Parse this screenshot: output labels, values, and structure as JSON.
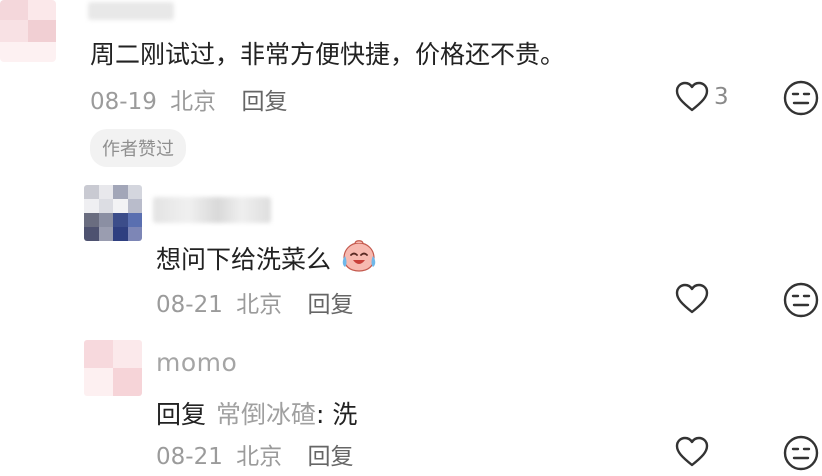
{
  "comments": [
    {
      "text": "周二刚试过，非常方便快捷，价格还不贵。",
      "date": "08-19",
      "location": "北京",
      "reply_label": "回复",
      "likes": "3",
      "badge": "作者赞过"
    },
    {
      "text": "想问下给洗菜么",
      "emoji_name": "crying-laughing-face-icon",
      "date": "08-21",
      "location": "北京",
      "reply_label": "回复"
    },
    {
      "username": "momo",
      "reply_prefix": "回复",
      "reply_target": "常倒冰碴",
      "reply_separator": ":",
      "text": "洗",
      "date": "08-21",
      "location": "北京",
      "reply_label": "回复"
    }
  ],
  "colors": {
    "primary_text": "#222222",
    "secondary_text": "#9b9b9b",
    "reply_link": "#666666",
    "badge_bg": "#f2f2f2",
    "badge_text": "#8f8f8f",
    "icon_stroke": "#333333"
  }
}
